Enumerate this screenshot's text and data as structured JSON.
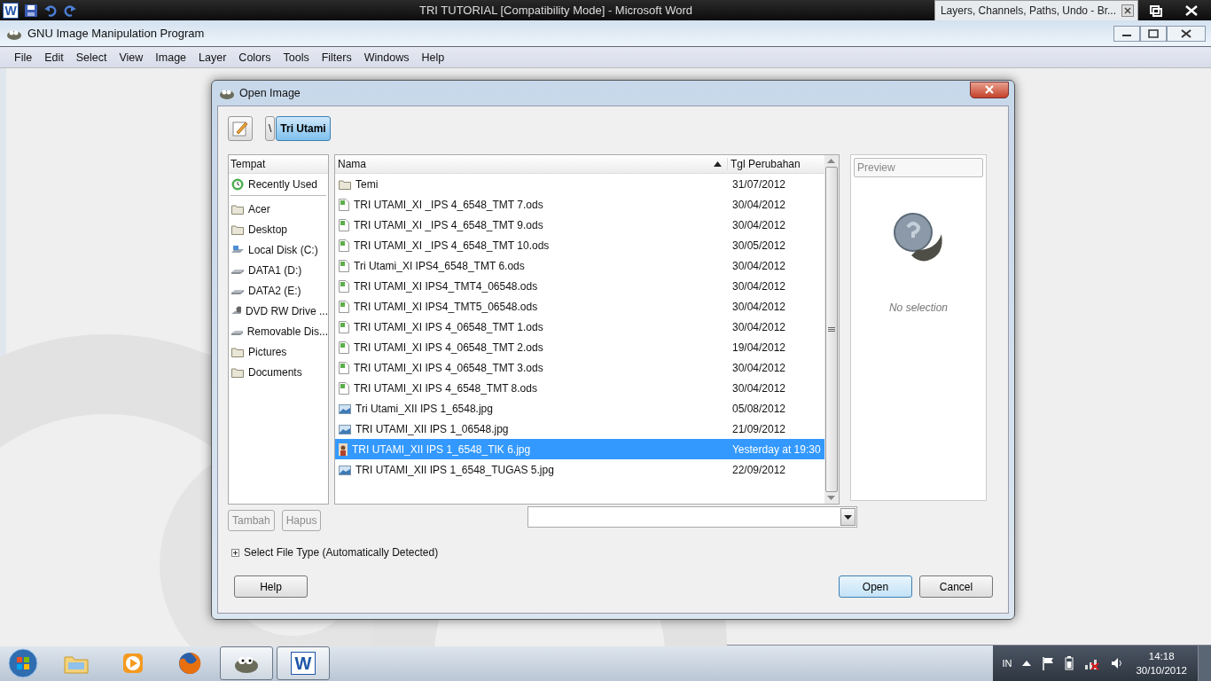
{
  "word_window": {
    "app_letter": "W",
    "title": "TRI TUTORIAL [Compatibility Mode]  -  Microsoft Word"
  },
  "floating_window": {
    "title": "Layers, Channels, Paths, Undo - Br..."
  },
  "gimp_window": {
    "title": "GNU Image Manipulation Program",
    "menu": [
      "File",
      "Edit",
      "Select",
      "View",
      "Image",
      "Layer",
      "Colors",
      "Tools",
      "Filters",
      "Windows",
      "Help"
    ]
  },
  "dialog": {
    "title": "Open Image",
    "path": [
      {
        "label": "\\",
        "selected": false
      },
      {
        "label": "Tri Utami",
        "selected": true
      }
    ],
    "places": {
      "header": "Tempat",
      "items": [
        {
          "label": "Recently Used",
          "kind": "recent"
        },
        {
          "label": "Acer",
          "kind": "folder"
        },
        {
          "label": "Desktop",
          "kind": "folder"
        },
        {
          "label": "Local Disk (C:)",
          "kind": "system"
        },
        {
          "label": "DATA1 (D:)",
          "kind": "disk"
        },
        {
          "label": "DATA2 (E:)",
          "kind": "disk"
        },
        {
          "label": "DVD RW Drive ...",
          "kind": "optical"
        },
        {
          "label": "Removable Dis...",
          "kind": "disk"
        },
        {
          "label": "Pictures",
          "kind": "folder"
        },
        {
          "label": "Documents",
          "kind": "folder"
        }
      ]
    },
    "place_buttons": [
      {
        "label": "Tambah",
        "disabled": true
      },
      {
        "label": "Hapus",
        "disabled": true
      }
    ],
    "files": {
      "columns": [
        "Nama",
        "Tgl Perubahan"
      ],
      "rows": [
        {
          "name": "Temi",
          "date": "31/07/2012",
          "kind": "folder",
          "selected": false
        },
        {
          "name": "TRI UTAMI_XI _IPS 4_6548_TMT 7.ods",
          "date": "30/04/2012",
          "kind": "sheet",
          "selected": false
        },
        {
          "name": "TRI UTAMI_XI _IPS 4_6548_TMT 9.ods",
          "date": "30/04/2012",
          "kind": "sheet",
          "selected": false
        },
        {
          "name": "TRI UTAMI_XI _IPS 4_6548_TMT 10.ods",
          "date": "30/05/2012",
          "kind": "sheet",
          "selected": false
        },
        {
          "name": "Tri Utami_XI IPS4_6548_TMT 6.ods",
          "date": "30/04/2012",
          "kind": "sheet",
          "selected": false
        },
        {
          "name": "TRI UTAMI_XI IPS4_TMT4_06548.ods",
          "date": "30/04/2012",
          "kind": "sheet",
          "selected": false
        },
        {
          "name": "TRI UTAMI_XI IPS4_TMT5_06548.ods",
          "date": "30/04/2012",
          "kind": "sheet",
          "selected": false
        },
        {
          "name": "TRI UTAMI_XI IPS 4_06548_TMT 1.ods",
          "date": "30/04/2012",
          "kind": "sheet",
          "selected": false
        },
        {
          "name": "TRI UTAMI_XI IPS 4_06548_TMT 2.ods",
          "date": "19/04/2012",
          "kind": "sheet",
          "selected": false
        },
        {
          "name": "TRI UTAMI_XI IPS 4_06548_TMT 3.ods",
          "date": "30/04/2012",
          "kind": "sheet",
          "selected": false
        },
        {
          "name": "TRI UTAMI_XI IPS 4_6548_TMT 8.ods",
          "date": "30/04/2012",
          "kind": "sheet",
          "selected": false
        },
        {
          "name": "Tri Utami_XII IPS 1_6548.jpg",
          "date": "05/08/2012",
          "kind": "image",
          "selected": false
        },
        {
          "name": "TRI UTAMI_XII IPS 1_06548.jpg",
          "date": "21/09/2012",
          "kind": "image",
          "selected": false
        },
        {
          "name": "TRI UTAMI_XII IPS 1_6548_TIK  6.jpg",
          "date": "Yesterday at 19:30",
          "kind": "thumb",
          "selected": true
        },
        {
          "name": "TRI UTAMI_XII IPS 1_6548_TUGAS 5.jpg",
          "date": "22/09/2012",
          "kind": "image",
          "selected": false
        }
      ]
    },
    "preview": {
      "label": "Preview",
      "message": "No selection"
    },
    "file_type_expander": {
      "label": "Select File Type (Automatically Detected)",
      "expanded": false
    },
    "actions": [
      {
        "label": "Help",
        "default": false
      },
      {
        "label": "Open",
        "default": true
      },
      {
        "label": "Cancel",
        "default": false
      }
    ]
  },
  "taskbar": {
    "apps": [
      {
        "kind": "explorer",
        "active": false
      },
      {
        "kind": "media",
        "active": false
      },
      {
        "kind": "browser",
        "active": false
      },
      {
        "kind": "gimp",
        "active": true
      },
      {
        "kind": "word",
        "active": true,
        "letter": "W"
      }
    ],
    "language": "IN",
    "time": "14:18",
    "date": "30/10/2012"
  }
}
